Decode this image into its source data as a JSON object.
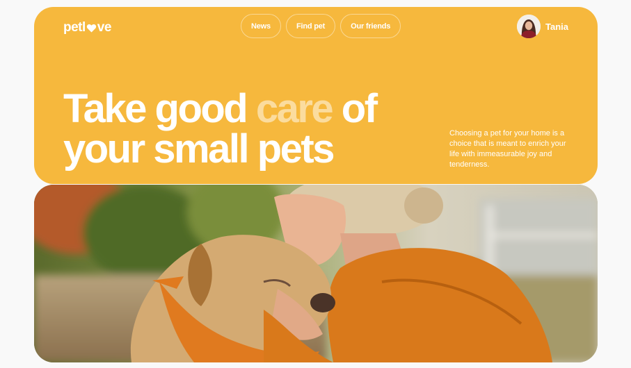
{
  "logo": {
    "text_left": "petl",
    "text_right": "ve",
    "heart_color": "#ffffff"
  },
  "nav": {
    "items": [
      "News",
      "Find pet",
      "Our friends"
    ]
  },
  "user": {
    "name": "Tania",
    "avatar_icon": "user-avatar"
  },
  "hero": {
    "title_part1": "Take good ",
    "title_accent": "care",
    "title_part2": " of",
    "title_line2": "your small pets",
    "description": "Choosing a pet for your home is a choice that is meant to enrich your life with immeasurable joy and tenderness.",
    "background_color": "#f6b83d"
  }
}
